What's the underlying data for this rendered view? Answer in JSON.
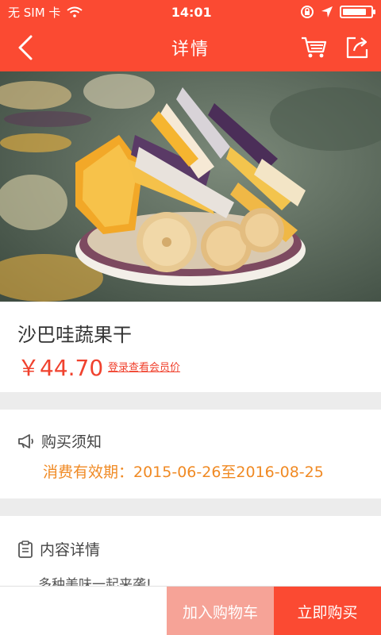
{
  "status_bar": {
    "carrier": "无 SIM 卡",
    "time": "14:01",
    "battery_level": 0.85
  },
  "nav": {
    "title": "详情",
    "back_icon": "chevron-left-icon",
    "cart_icon": "cart-icon",
    "share_icon": "share-icon"
  },
  "hero": {
    "image": "dried-fruit-vegetable-chips-photo"
  },
  "product": {
    "name": "沙巴哇蔬果干",
    "price": "￥44.70",
    "member_link": "登录查看会员价"
  },
  "purchase_notice": {
    "title": "购买须知",
    "icon": "megaphone-icon",
    "validity": "消费有效期：2015-06-26至2016-08-25"
  },
  "content_detail": {
    "title": "内容详情",
    "icon": "clipboard-icon",
    "description": "多种美味一起来袭!"
  },
  "actions": {
    "add_to_cart": "加入购物车",
    "buy_now": "立即购买"
  },
  "colors": {
    "brand": "#fb4a32",
    "price": "#f0422e",
    "validity": "#f08a24",
    "add_cart_bg": "#f6a397"
  }
}
